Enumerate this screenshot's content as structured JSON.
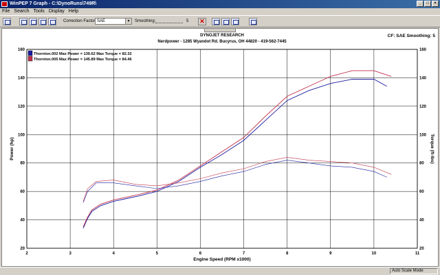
{
  "window": {
    "title": "WinPEP 7  Graph - C:\\DynoRuns\\749R\\"
  },
  "menu": [
    "File",
    "Search",
    "Tools",
    "Display",
    "Help"
  ],
  "toolbar": {
    "correction_label": "Correction Factor",
    "correction_value": "SAE",
    "smoothing_label": "Smoothing:",
    "smoothing_value": "5"
  },
  "status": {
    "mode": "Auto Scale Mode"
  },
  "colors": {
    "series1": "#1a1aa0",
    "series2": "#c0304a",
    "titlebar": "#0a246a"
  },
  "chart_data": {
    "type": "line",
    "header_line1": "DYNOJET RESEARCH",
    "header_line2": "Nerdpower - 1285 Wyandot Rd. Bucyrus, OH  44820 - 419-562-7445",
    "corner_info": "CF: SAE  Smoothing: 5",
    "xlabel": "Engine Speed (RPM x1000)",
    "ylabel_left": "Power (hp)",
    "ylabel_right": "Torque (ft-lbs)",
    "xlim": [
      2,
      11
    ],
    "ylim": [
      20,
      160
    ],
    "x_ticks": [
      "2",
      "3",
      "4",
      "5",
      "6",
      "7",
      "8",
      "9",
      "10",
      "11"
    ],
    "y_ticks": [
      "20",
      "40",
      "60",
      "80",
      "100",
      "120",
      "140",
      "160"
    ],
    "grid": true,
    "legend_position": "top-left",
    "legend": [
      "Thornton.002 Max Power = 139.62 Max Torque = 82.32",
      "Thornton.005 Max Power = 145.89 Max Torque = 84.46"
    ],
    "series": [
      {
        "name": "Thornton.002",
        "kind": "power",
        "x": [
          3.3,
          3.4,
          3.5,
          3.7,
          4.0,
          4.3,
          4.6,
          5.0,
          5.5,
          6.0,
          6.5,
          7.0,
          7.5,
          8.0,
          8.5,
          9.0,
          9.5,
          10.0,
          10.3
        ],
        "y": [
          34,
          41,
          46,
          50,
          53,
          55,
          57,
          60,
          67,
          77,
          86,
          96,
          110,
          124,
          131,
          136,
          139,
          139,
          134
        ]
      },
      {
        "name": "Thornton.005",
        "kind": "power",
        "x": [
          3.3,
          3.4,
          3.5,
          3.7,
          4.0,
          4.3,
          4.6,
          5.0,
          5.5,
          6.0,
          6.5,
          7.0,
          7.5,
          8.0,
          8.5,
          9.0,
          9.5,
          10.0,
          10.4
        ],
        "y": [
          35,
          42,
          47,
          51,
          54,
          56,
          58,
          61,
          68,
          78,
          88,
          98,
          113,
          127,
          134,
          141,
          145,
          145,
          141
        ]
      },
      {
        "name": "Thornton.002",
        "kind": "torque",
        "x": [
          3.3,
          3.4,
          3.6,
          4.0,
          4.5,
          5.0,
          5.5,
          6.0,
          6.5,
          7.0,
          7.5,
          8.0,
          8.5,
          9.0,
          9.5,
          10.0,
          10.3
        ],
        "y": [
          52,
          60,
          66,
          66,
          64,
          62,
          64,
          67,
          71,
          74,
          79,
          82,
          80,
          78,
          77,
          74,
          70
        ]
      },
      {
        "name": "Thornton.005",
        "kind": "torque",
        "x": [
          3.3,
          3.4,
          3.6,
          4.0,
          4.5,
          5.0,
          5.5,
          6.0,
          6.5,
          7.0,
          7.5,
          8.0,
          8.5,
          9.0,
          9.5,
          10.0,
          10.4
        ],
        "y": [
          53,
          62,
          67,
          68,
          65,
          64,
          66,
          69,
          73,
          76,
          81,
          84,
          82,
          81,
          80,
          77,
          72
        ]
      }
    ]
  }
}
